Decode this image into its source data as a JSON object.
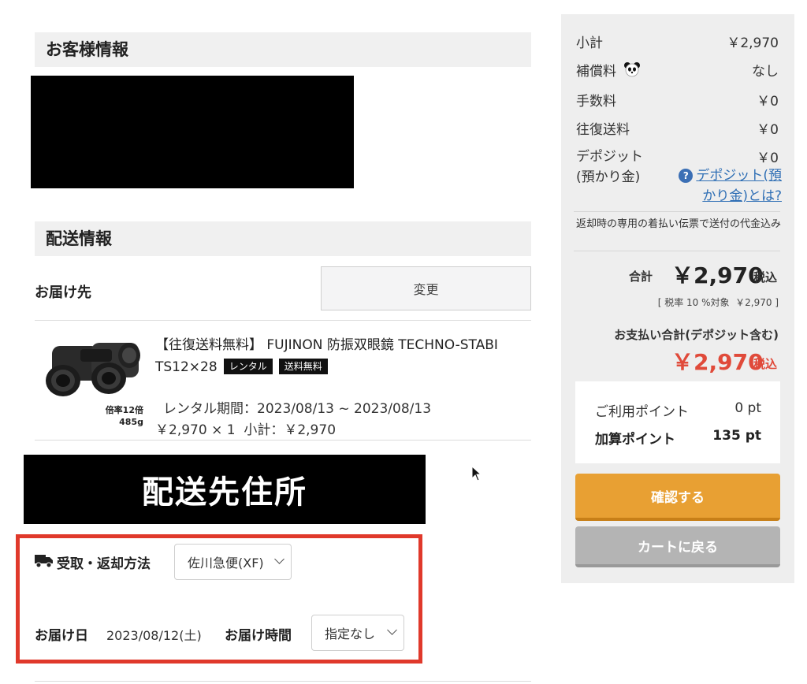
{
  "customer_section": {
    "title": "お客様情報"
  },
  "shipping_section": {
    "title": "配送情報"
  },
  "delivery_to": {
    "label": "お届け先",
    "change_button": "変更"
  },
  "product": {
    "title": "【往復送料無料】 FUJINON 防振双眼鏡 TECHNO-STABI TS12×28",
    "badge_rental": "レンタル",
    "badge_free_shipping": "送料無料",
    "image_caption_line1": "倍率12倍",
    "image_caption_line2": "485g",
    "rental_period": "レンタル期間：2023/08/13 ~ 2023/08/13",
    "price_line": "￥2,970 × 1  小計：￥2,970"
  },
  "redacted_address_banner": "配送先住所",
  "delivery_method": {
    "label": "受取・返却方法",
    "selected": "佐川急便(XF)"
  },
  "delivery_date": {
    "label": "お届け日",
    "value": "2023/08/12(土)",
    "time_label": "お届け時間",
    "time_selected": "指定なし"
  },
  "summary": {
    "subtotal_label": "小計",
    "subtotal_value": "￥2,970",
    "compensation_label": "補償料",
    "compensation_value": "なし",
    "fee_label": "手数料",
    "fee_value": "￥0",
    "round_trip_label": "往復送料",
    "round_trip_value": "￥0",
    "deposit_label_line1": "デポジット",
    "deposit_label_line2": "(預かり金)",
    "deposit_value": "￥0",
    "deposit_link": "デポジット(預かり金)とは?",
    "note": "返却時の専用の着払い伝票で送付の代金込み",
    "total_label": "合計",
    "total_value": "￥2,970",
    "tax_label": "税込",
    "tax_breakdown": "[ 税率 10 %対象  ￥2,970 ]",
    "payment_total_label": "お支払い合計(デポジット含む)",
    "payment_total_value": "￥2,970",
    "payment_tax_label": "税込",
    "accent_color": "#e04a3a"
  },
  "points": {
    "used_label": "ご利用ポイント",
    "used_value": "0 pt",
    "added_label": "加算ポイント",
    "added_value": "135 pt"
  },
  "buttons": {
    "confirm": "確認する",
    "back_to_cart": "カートに戻る"
  }
}
